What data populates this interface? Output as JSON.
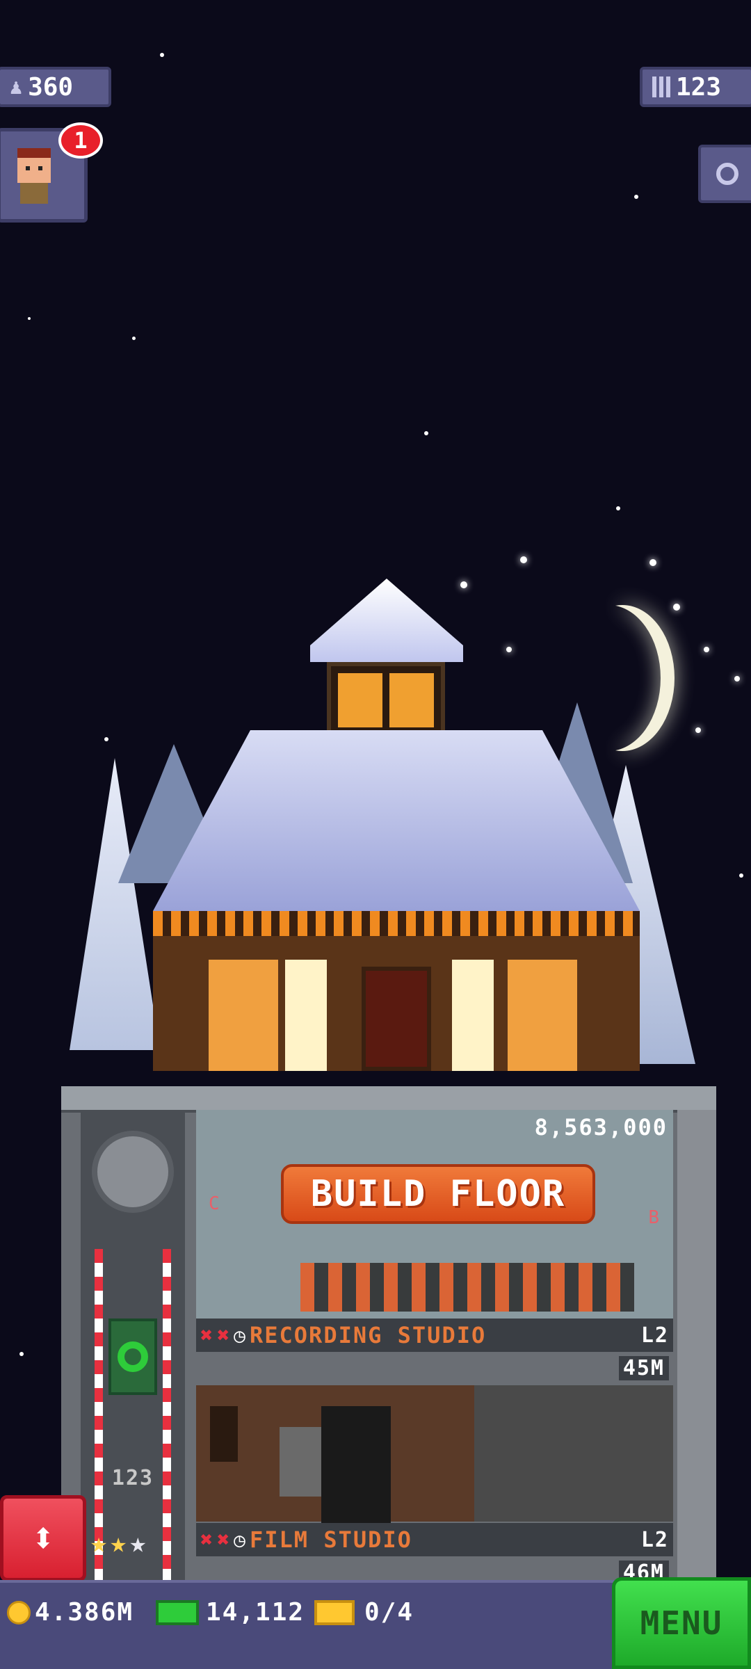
{
  "hud": {
    "population": "360",
    "floors": "123",
    "notification_count": "1"
  },
  "tower": {
    "build_cost": "8,563,000",
    "build_label": "BUILD FLOOR",
    "floors": [
      {
        "name": "RECORDING STUDIO",
        "level": "L2",
        "income": "45M",
        "stock_letters": [
          "C",
          "B"
        ]
      },
      {
        "name": "FILM STUDIO",
        "level": "L2",
        "income": "46M"
      }
    ],
    "elevator_floor": "123"
  },
  "bottom_bar": {
    "coins": "4.386M",
    "bux": "14,112",
    "tickets": "0/4",
    "menu_label": "MENU"
  },
  "colors": {
    "sky": "#0b0a1a",
    "hud_pill": "#5a5a8a",
    "build_button": "#e85a22",
    "menu_button": "#2ecc3a",
    "elevator_button": "#e8303f",
    "floor_text": "#e87a3a"
  },
  "icons": {
    "population": "person-icon",
    "floors": "building-icon",
    "search": "magnifier-icon",
    "coin": "coin-icon",
    "bux": "bux-icon",
    "ticket": "ticket-icon",
    "elevator": "up-down-arrow-icon"
  }
}
